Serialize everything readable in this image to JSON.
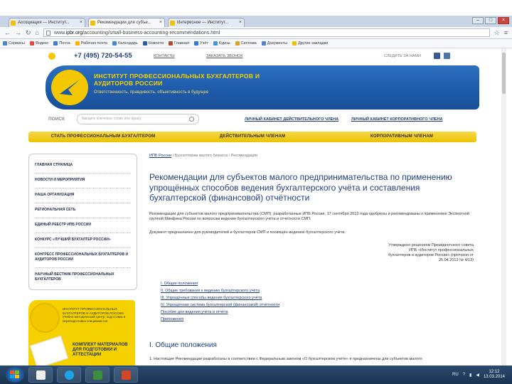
{
  "browser": {
    "tabs": [
      {
        "label": "Ассоциация — Институт...",
        "active": false
      },
      {
        "label": "Рекомендации для субъе...",
        "active": true
      },
      {
        "label": "Интересное — Институт...",
        "active": false
      }
    ],
    "url_prefix": "www.",
    "url_host": "ipbr.org",
    "url_path": "/accounting/small-business-accounting-recommendations.html",
    "bookmarks": [
      {
        "label": "Сервисы",
        "color": "#4a86c8"
      },
      {
        "label": "Яндекс",
        "color": "#e04c3c"
      },
      {
        "label": "Почта",
        "color": "#3d7dd1"
      },
      {
        "label": "Рабочая почта",
        "color": "#ffb000"
      },
      {
        "label": "Календарь",
        "color": "#4a86c8"
      },
      {
        "label": "Новости",
        "color": "#2b5ea8"
      },
      {
        "label": "Главная",
        "color": "#b54a2c"
      },
      {
        "label": "Учёт",
        "color": "#2b7bd8"
      },
      {
        "label": "Курсы",
        "color": "#3f9ad6"
      },
      {
        "label": "Система",
        "color": "#e0a020"
      },
      {
        "label": "Документы",
        "color": "#4a86c8"
      },
      {
        "label": "Другие закладки",
        "color": "#f0c000"
      }
    ]
  },
  "header": {
    "phone": "+7 (495) 720-54-55",
    "link1": "КОНТАКТЫ",
    "link2": "ЗАКАЗАТЬ ЗВОНОК",
    "follow": "СЛЕДИТЕ ЗА НАМИ",
    "banner_title": "ИНСТИТУТ ПРОФЕССИОНАЛЬНЫХ БУХГАЛТЕРОВ И АУДИТОРОВ РОССИИ",
    "banner_sub": "Ответственность, правдивость, объективность в будущее",
    "search_label": "ПОИСК",
    "search_placeholder": "Введите ключевое слово или фразу",
    "cab_personal": "ЛИЧНЫЙ КАБИНЕТ ДЕЙСТВИТЕЛЬНОГО ЧЛЕНА",
    "cab_corporate": "ЛИЧНЫЙ КАБИНЕТ КОРПОРАТИВНОГО ЧЛЕНА"
  },
  "nav": [
    "СТАТЬ ПРОФЕССИОНАЛЬНЫМ БУХГАЛТЕРОМ",
    "ДЕЙСТВИТЕЛЬНЫМ ЧЛЕНАМ",
    "КОРПОРАТИВНЫМ ЧЛЕНАМ"
  ],
  "sidebar": [
    "ГЛАВНАЯ СТРАНИЦА",
    "НОВОСТИ И МЕРОПРИЯТИЯ",
    "НАША ОРГАНИЗАЦИЯ",
    "РЕГИОНАЛЬНАЯ СЕТЬ",
    "ЕДИНЫЙ РЕЕСТР ИПБ РОССИИ",
    "КОНКУРС «ЛУЧШИЙ БУХГАЛТЕР РОССИИ»",
    "КОНГРЕСС ПРОФЕССИОНАЛЬНЫХ БУХГАЛТЕРОВ И АУДИТОРОВ РОССИИ",
    "НАУЧНЫЙ ВЕСТНИК ПРОФЕССИОНАЛЬНЫХ БУХГАЛТЕРОВ"
  ],
  "promo": {
    "text": "ИНСТИТУТ ПРОФЕССИОНАЛЬНЫХ БУХГАЛТЕРОВ И АУДИТОРОВ РОССИИ. Учебно-методический центр: подготовка и переподготовка специалистов",
    "big": "КОМПЛЕКТ МАТЕРИАЛОВ ДЛЯ ПОДГОТОВКИ И АТТЕСТАЦИИ"
  },
  "content": {
    "crumb_home": "ИПБ России",
    "crumb_rest": "/ Бухгалтерам малого бизнеса / Рекомендации",
    "title": "Рекомендации для субъектов малого предпринимательства по применению упрощённых способов ведения бухгалтерского учёта и составления бухгалтерской (финансовой) отчётности",
    "para1": "Рекомендации для субъектов малого предпринимательства (СМП), разработанные ИПБ России, 17 сентября 2013 года одобрены и рекомендованы к применению Экспертной группой Минфина России по вопросам ведения бухгалтерского учёта и отчётности СМП.",
    "para2": "Документ предназначен для руководителей и бухгалтеров СМП и посвящён ведению бухгалтерского учёта.",
    "approved": "Утверждено решением Президентского совета ИПБ «Институт профессиональных бухгалтеров и аудиторов России» (протокол от 25.04.2013 № 4/13)",
    "toc": [
      "I. Общие положения",
      "II. Общие требования к ведению бухгалтерского учёта",
      "III. Упрощённые способы ведения бухгалтерского учёта",
      "IV. Упрощённая система бухгалтерской (финансовой) отчётности",
      "Пособие для ведения учёта и отчёта",
      "Приложения"
    ],
    "section_title": "I. Общие положения",
    "last_para": "1. Настоящие Рекомендации разработаны в соответствии с Федеральным законом «О бухгалтерском учёте» и предназначены для субъектов малого"
  },
  "taskbar": {
    "lang": "RU",
    "time": "12:12",
    "date": "13.03.2014"
  }
}
